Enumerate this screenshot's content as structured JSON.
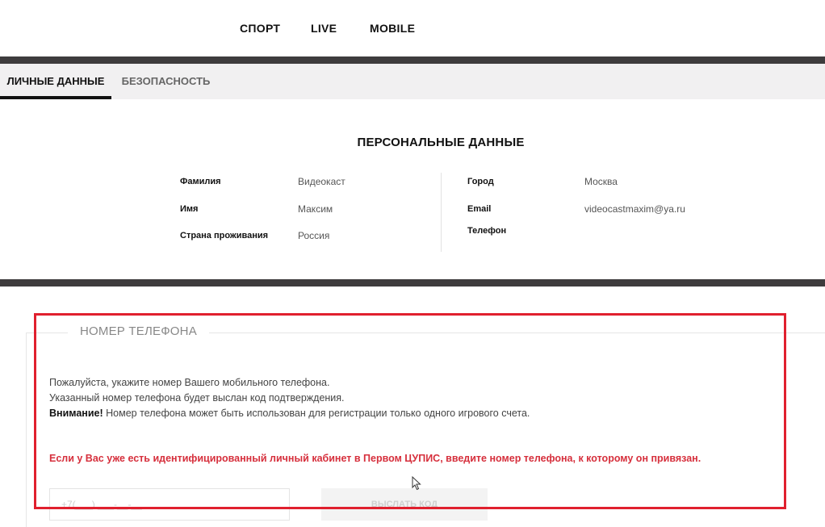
{
  "topnav": {
    "items": [
      "СПОРТ",
      "LIVE",
      "MOBILE"
    ]
  },
  "tabs": [
    {
      "label": "ЛИЧНЫЕ ДАННЫЕ",
      "active": true
    },
    {
      "label": "БЕЗОПАСНОСТЬ",
      "active": false
    }
  ],
  "personal": {
    "title": "ПЕРСОНАЛЬНЫЕ ДАННЫЕ",
    "left": [
      {
        "label": "Фамилия",
        "value": "Видеокаст"
      },
      {
        "label": "Имя",
        "value": "Максим"
      },
      {
        "label": "Страна проживания",
        "value": "Россия"
      }
    ],
    "right": [
      {
        "label": "Город",
        "value": "Москва"
      },
      {
        "label": "Email",
        "value": "videocastmaxim@ya.ru"
      },
      {
        "label": "Телефон",
        "value": ""
      }
    ]
  },
  "phone": {
    "legend": "НОМЕР ТЕЛЕФОНА",
    "line1": "Пожалуйста, укажите номер Вашего мобильного телефона.",
    "line2": "Указанный номер телефона будет выслан код подтверждения.",
    "warning_bold": "Внимание!",
    "warning_text": " Номер телефона может быть использован для регистрации только одного игрового счета.",
    "alert": "Если у Вас уже есть идентифицированный личный кабинет в Первом ЦУПИС, введите номер телефона, к которому он привязан.",
    "input_placeholder": "+7(___) ___-__-__",
    "send_label": "ВЫСЛАТЬ КОД"
  },
  "colors": {
    "bar": "#3e3c3d",
    "tabs_bg": "#f1f0f1",
    "alert": "#d62f3c",
    "highlight": "#e0202e"
  }
}
